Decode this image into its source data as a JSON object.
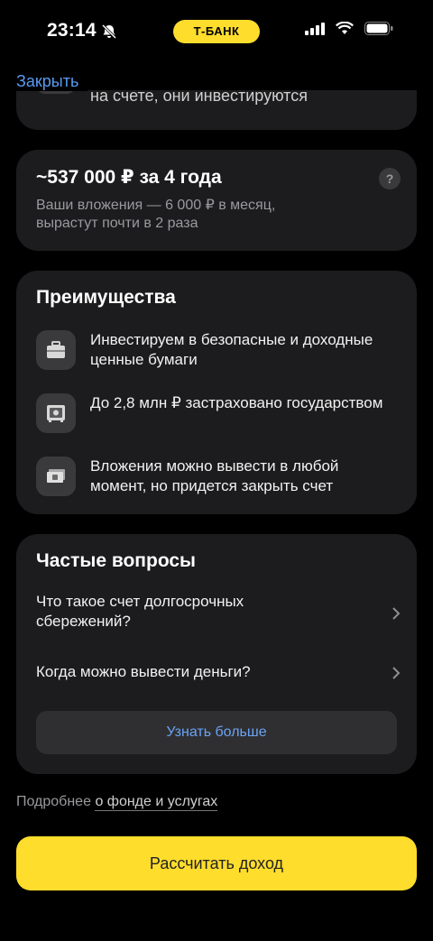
{
  "status_bar": {
    "time": "23:14",
    "bank_label": "Т-БАНК"
  },
  "nav": {
    "close_label": "Закрыть"
  },
  "partial_card": {
    "text": "на счете, они инвестируются"
  },
  "income": {
    "title": "~537 000 ₽ за 4 года",
    "subtitle": "Ваши вложения — 6 000 ₽ в месяц, вырастут почти в 2 раза",
    "help": "?"
  },
  "advantages": {
    "title": "Преимущества",
    "items": [
      {
        "icon": "briefcase-icon",
        "text": "Инвестируем в безопасные и доходные ценные бумаги"
      },
      {
        "icon": "safe-icon",
        "text": "До 2,8 млн ₽ застраховано государством"
      },
      {
        "icon": "banknote-icon",
        "text": "Вложения можно вывести в любой момент, но придется закрыть счет"
      }
    ]
  },
  "faq": {
    "title": "Частые вопросы",
    "items": [
      {
        "text": "Что такое счет долгосрочных сбережений?"
      },
      {
        "text": "Когда можно вывести деньги?"
      }
    ],
    "more_label": "Узнать больше"
  },
  "details": {
    "prefix": "Подробнее",
    "link": "о фонде и услугах"
  },
  "cta": {
    "label": "Рассчитать доход"
  },
  "colors": {
    "accent": "#ffdd2d",
    "link": "#5a9bf0",
    "card": "#1c1c1e"
  }
}
